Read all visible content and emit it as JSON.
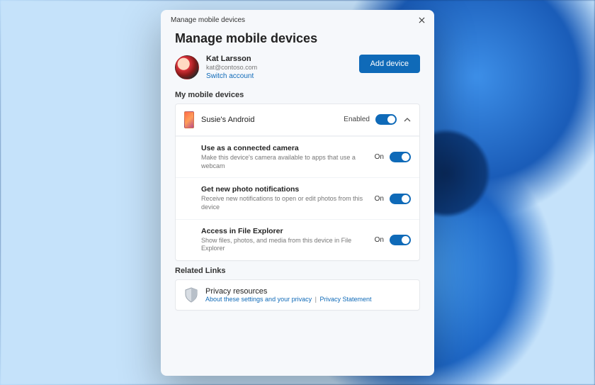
{
  "window": {
    "title": "Manage mobile devices"
  },
  "header": {
    "title": "Manage mobile devices"
  },
  "user": {
    "name": "Kat Larsson",
    "email": "kat@contoso.com",
    "switch_label": "Switch account"
  },
  "actions": {
    "add_device": "Add device"
  },
  "sections": {
    "devices_label": "My mobile devices",
    "related_label": "Related Links"
  },
  "device": {
    "name": "Susie's Android",
    "status": "Enabled",
    "settings": [
      {
        "title": "Use as a connected camera",
        "desc": "Make this device's camera available to apps that use a webcam",
        "state": "On"
      },
      {
        "title": "Get new photo notifications",
        "desc": "Receive new notifications to open or edit photos from this device",
        "state": "On"
      },
      {
        "title": "Access in File Explorer",
        "desc": "Show files, photos, and media from this device in File Explorer",
        "state": "On"
      }
    ]
  },
  "related": {
    "title": "Privacy resources",
    "link1": "About these settings and your privacy",
    "sep": "|",
    "link2": "Privacy Statement"
  }
}
